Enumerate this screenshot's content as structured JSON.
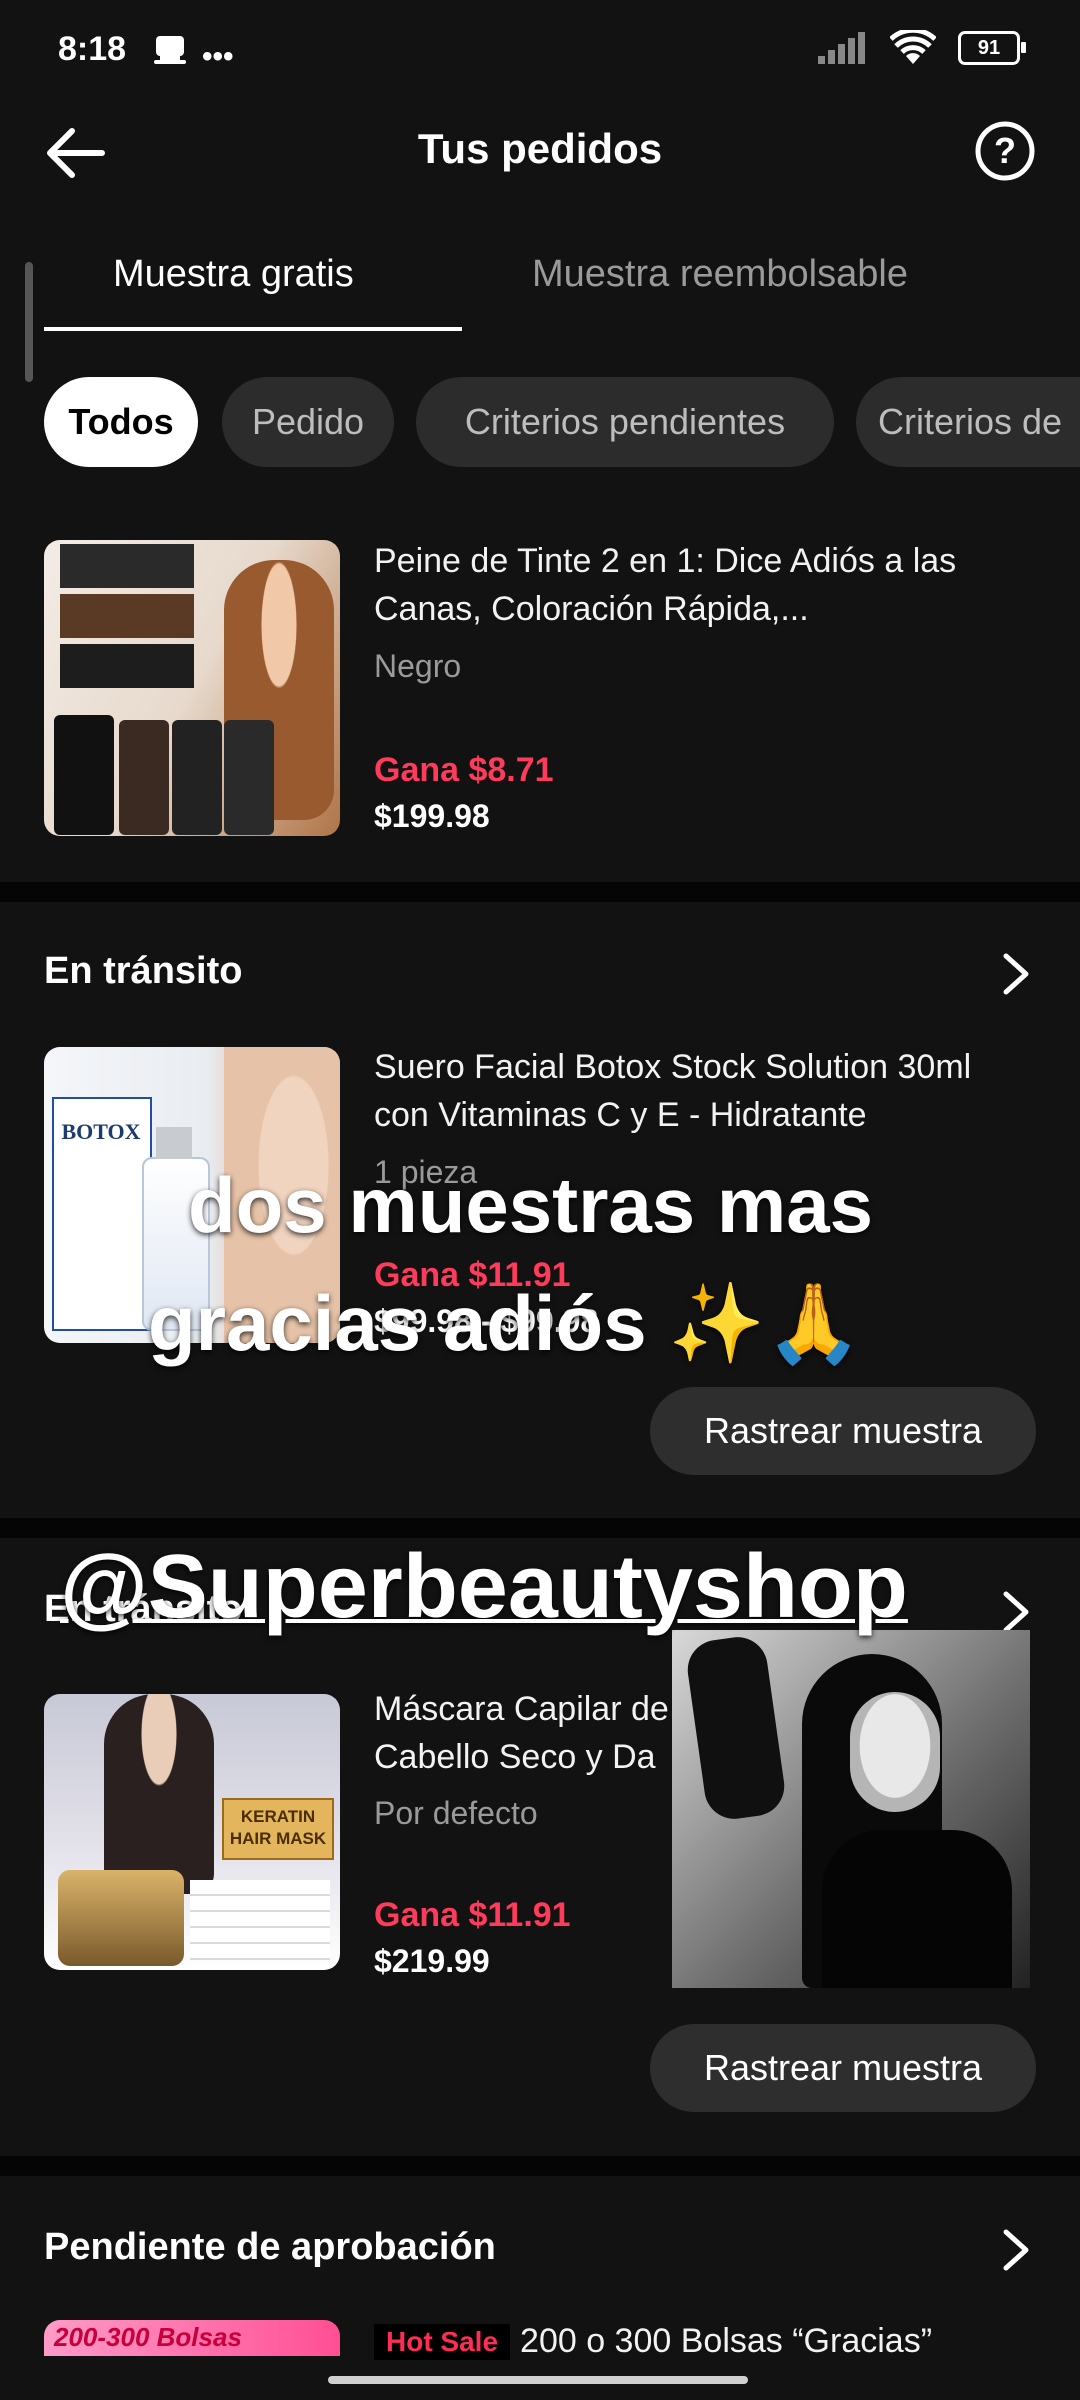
{
  "status_bar": {
    "time": "8:18",
    "battery": "91"
  },
  "header": {
    "title": "Tus pedidos"
  },
  "tabs": [
    {
      "label": "Muestra gratis"
    },
    {
      "label": "Muestra reembolsable"
    }
  ],
  "chips": [
    {
      "label": "Todos"
    },
    {
      "label": "Pedido"
    },
    {
      "label": "Criterios pendientes"
    },
    {
      "label": "Criterios de"
    }
  ],
  "orders": [
    {
      "title": "Peine de Tinte 2 en 1: Dice Adiós a las Canas, Coloración Rápida,...",
      "variant": "Negro",
      "earn": "Gana $8.71",
      "price": "$199.98"
    }
  ],
  "sections": [
    {
      "title": "En tránsito",
      "item": {
        "title": "Suero Facial Botox Stock Solution 30ml con Vitaminas C y E - Hidratante",
        "variant": "1 pieza",
        "earn": "Gana $11.91",
        "price": "$99.98 - $99.98"
      },
      "button": "Rastrear muestra"
    },
    {
      "title": "En tránsito",
      "item": {
        "title": "Máscara Capilar de Cabello Seco y Da",
        "variant": "Por defecto",
        "earn": "Gana $11.91",
        "price": "$219.99"
      },
      "button": "Rastrear muestra"
    },
    {
      "title": "Pendiente de aprobación",
      "item": {
        "hot_badge": "Hot Sale",
        "title": "200 o 300 Bolsas “Gracias”"
      }
    }
  ],
  "overlay": {
    "line1": "dos muestras mas",
    "line2": "gracias adiós ✨🙏",
    "handle": "@Superbeautyshop"
  },
  "product_images": {
    "botox_label": "BOTOX",
    "keratin_label": "KERATIN HAIR MASK",
    "bolsas_label": "200-300 Bolsas"
  },
  "colors": {
    "accent_red": "#ff3b5c",
    "background": "#121212",
    "chip_bg": "#2c2c2c"
  }
}
